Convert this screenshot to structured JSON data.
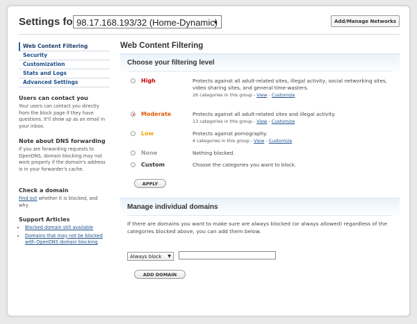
{
  "header": {
    "title": "Settings for:",
    "network_value": "98.17.168.193/32 (Home-Dynamic)",
    "add_manage_label": "Add/Manage Networks"
  },
  "nav": {
    "items": [
      {
        "label": "Web Content Filtering",
        "active": true
      },
      {
        "label": "Security"
      },
      {
        "label": "Customization"
      },
      {
        "label": "Stats and Logs"
      },
      {
        "label": "Advanced Settings"
      }
    ]
  },
  "sidebar": {
    "contact": {
      "heading": "Users can contact you",
      "text": "Your users can contact you directly from the block page if they have questions. It'll show up as an email in your inbox."
    },
    "dns": {
      "heading": "Note about DNS forwarding",
      "text": "If you are forwarding requests to OpenDNS, domain blocking may not work properly if the domain's address is in your forwarder's cache."
    },
    "check": {
      "heading": "Check a domain",
      "link": "Find out",
      "text": " whether it is blocked, and why."
    },
    "support": {
      "heading": "Support Articles",
      "articles": [
        "Blocked domain still available",
        "Domains that may not be blocked with OpenDNS domain blocking"
      ]
    }
  },
  "main": {
    "title": "Web Content Filtering",
    "filtering": {
      "title": "Choose your filtering level",
      "levels": [
        {
          "name": "High",
          "color": "#cc0000",
          "desc": "Protects against all adult-related sites, illegal activity, social networking sites, video sharing sites, and general time-wasters.",
          "count": "26",
          "meta": "categories in this group -",
          "view": "View",
          "customize": "Customize",
          "checked": false
        },
        {
          "name": "Moderate",
          "color": "#e05a00",
          "desc": "Protects against all adult-related sites and illegal activity.",
          "count": "13",
          "meta": "categories in this group -",
          "view": "View",
          "customize": "Customize",
          "checked": true
        },
        {
          "name": "Low",
          "color": "#f0a000",
          "desc": "Protects against pornography.",
          "count": "4",
          "meta": "categories in this group -",
          "view": "View",
          "customize": "Customize",
          "checked": false
        },
        {
          "name": "None",
          "color": "#999999",
          "desc": "Nothing blocked.",
          "checked": false
        },
        {
          "name": "Custom",
          "color": "#333333",
          "desc": "Choose the categories you want to block.",
          "checked": false
        }
      ],
      "apply_label": "APPLY"
    },
    "domains": {
      "title": "Manage individual domains",
      "text": "If there are domains you want to make sure are always blocked (or always allowed) regardless of the categories blocked above, you can add them below.",
      "select_value": "Always block",
      "input_value": "",
      "add_label": "ADD DOMAIN"
    }
  }
}
